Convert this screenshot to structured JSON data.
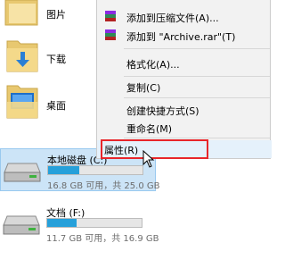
{
  "nav": {
    "pictures": "图片",
    "downloads": "下载",
    "desktop": "桌面"
  },
  "drives": [
    {
      "name": "本地磁盘 (C:)",
      "capacity": "16.8 GB 可用，共 25.0 GB",
      "used_fraction": 0.33,
      "selected": true
    },
    {
      "name": "文档 (F:)",
      "capacity": "11.7 GB 可用，共 16.9 GB",
      "used_fraction": 0.31,
      "selected": false
    }
  ],
  "context_menu": {
    "items": [
      {
        "label": "添加到压缩文件(A)...",
        "icon": "winrar-icon"
      },
      {
        "label": "添加到 \"Archive.rar\"(T)",
        "icon": "winrar-icon"
      },
      {
        "label": "格式化(A)..."
      },
      {
        "label": "复制(C)"
      },
      {
        "label": "创建快捷方式(S)"
      },
      {
        "label": "重命名(M)"
      },
      {
        "label": "属性(R)"
      }
    ]
  },
  "colors": {
    "accent": "#26a0da",
    "selection": "#cce4f7",
    "highlight_box": "#e8262b"
  }
}
